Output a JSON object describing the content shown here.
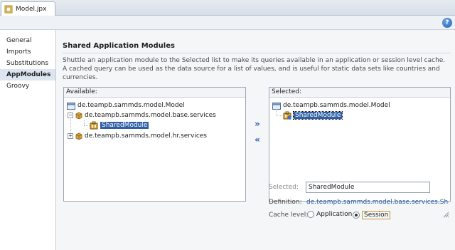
{
  "tab": {
    "title": "Model.jpx",
    "icon": "project-file-icon"
  },
  "toolbar": {
    "help_label": "?"
  },
  "nav": {
    "items": [
      {
        "label": "General",
        "active": false
      },
      {
        "label": "Imports",
        "active": false
      },
      {
        "label": "Substitutions",
        "active": false
      },
      {
        "label": "AppModules",
        "active": true
      },
      {
        "label": "Groovy",
        "active": false
      }
    ]
  },
  "page": {
    "title": "Shared Application Modules",
    "description": "Shuttle an application module to the Selected list to make its queries available in an application or session level cache. A cached query can be used as the data source for a list of values, and is useful for static data sets like countries and currencies."
  },
  "available": {
    "header": "Available:",
    "root": "de.teampb.sammds.model.Model",
    "packages": [
      {
        "label": "de.teampb.sammds.model.base.services",
        "expanded": true,
        "children": [
          "SharedModule"
        ]
      },
      {
        "label": "de.teampb.sammds.model.hr.services",
        "expanded": false,
        "children": []
      }
    ],
    "expanded_sign": "−",
    "collapsed_sign": "+"
  },
  "shuttle": {
    "add": "»",
    "remove": "«"
  },
  "selected": {
    "header": "Selected:",
    "root": "de.teampb.sammds.model.Model",
    "items": [
      "SharedModule"
    ]
  },
  "details": {
    "selected_label": "Selected:",
    "selected_value": "SharedModule",
    "definition_label": "Definition:",
    "definition_value": "de.teampb.sammds.model.base.services.Sha...",
    "cache_level_label": "Cache level:",
    "options": [
      {
        "label": "Application",
        "checked": false
      },
      {
        "label": "Session",
        "checked": true
      }
    ]
  },
  "colors": {
    "selection": "#2f5fa4",
    "link": "#2a5da0",
    "accent": "#1d5fb3"
  }
}
